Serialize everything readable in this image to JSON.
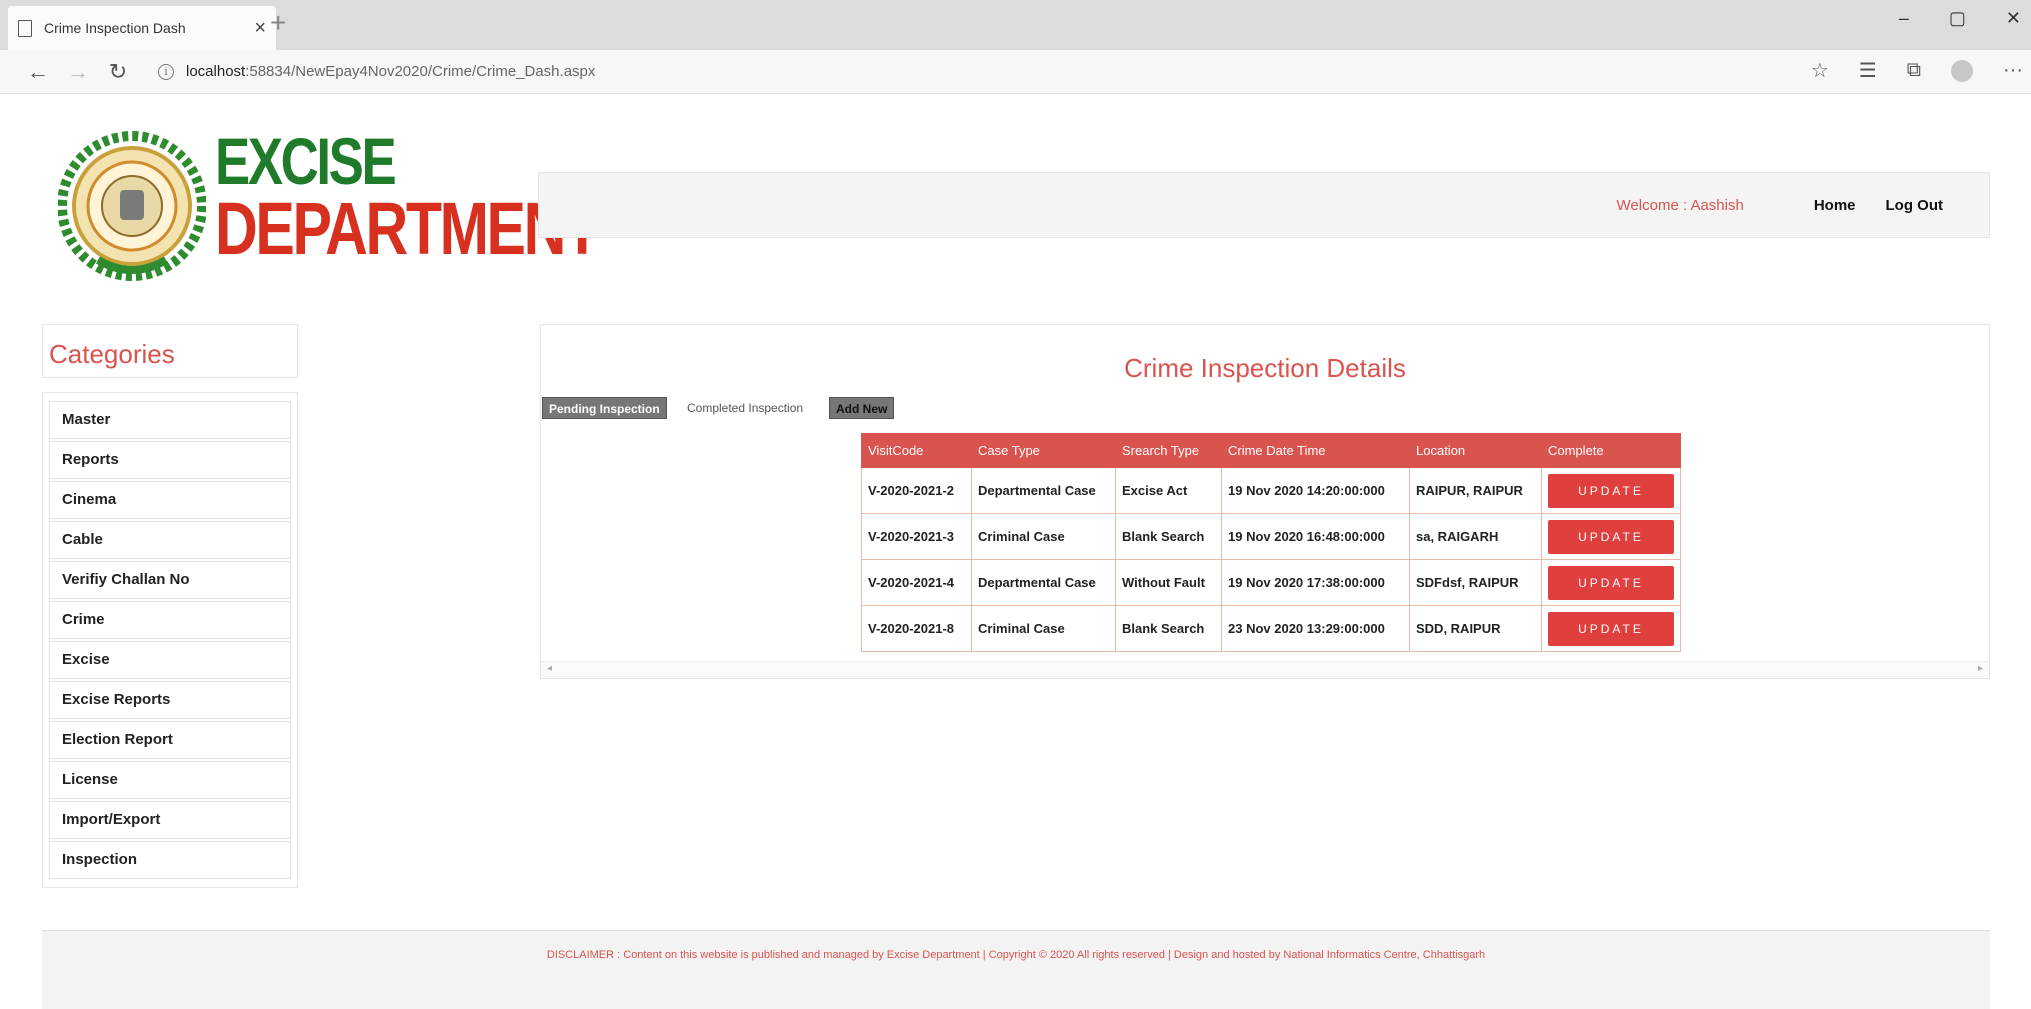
{
  "browser": {
    "tab_title": "Crime Inspection Dash",
    "tab_close": "×",
    "new_tab": "+",
    "url_host": "localhost",
    "url_rest": ":58834/NewEpay4Nov2020/Crime/Crime_Dash.aspx",
    "window_buttons": [
      "–",
      "▢",
      "✕"
    ]
  },
  "header": {
    "brand_line1": "EXCISE",
    "brand_line2": "DEPARTMENT",
    "welcome": "Welcome : Aashish",
    "home": "Home",
    "logout": "Log Out"
  },
  "sidebar": {
    "title": "Categories",
    "items": [
      "Master",
      "Reports",
      "Cinema",
      "Cable",
      "Verifiy Challan No",
      "Crime",
      "Excise",
      "Excise Reports",
      "Election Report",
      "License",
      "Import/Export",
      "Inspection"
    ]
  },
  "main": {
    "title": "Crime Inspection Details",
    "tabs": {
      "pending": "Pending Inspection",
      "completed": "Completed Inspection",
      "add_new": "Add New"
    },
    "table": {
      "headers": [
        "VisitCode",
        "Case Type",
        "Srearch Type",
        "Crime Date Time",
        "Location",
        "Complete"
      ],
      "rows": [
        [
          "V-2020-2021-2",
          "Departmental Case",
          "Excise Act",
          "19 Nov 2020 14:20:00:000",
          "RAIPUR, RAIPUR",
          "UPDATE"
        ],
        [
          "V-2020-2021-3",
          "Criminal Case",
          "Blank Search",
          "19 Nov 2020 16:48:00:000",
          "sa, RAIGARH",
          "UPDATE"
        ],
        [
          "V-2020-2021-4",
          "Departmental Case",
          "Without Fault",
          "19 Nov 2020 17:38:00:000",
          "SDFdsf, RAIPUR",
          "UPDATE"
        ],
        [
          "V-2020-2021-8",
          "Criminal Case",
          "Blank Search",
          "23 Nov 2020 13:29:00:000",
          "SDD, RAIPUR",
          "UPDATE"
        ]
      ]
    }
  },
  "footer": {
    "text": "DISCLAIMER : Content on this website is published and managed by Excise Department | Copyright © 2020 All rights reserved | Design and hosted by National Informatics Centre, Chhattisgarh"
  },
  "colors": {
    "accent": "#d9534f",
    "brand_green": "#1f7a2a",
    "brand_red": "#d7301f"
  }
}
